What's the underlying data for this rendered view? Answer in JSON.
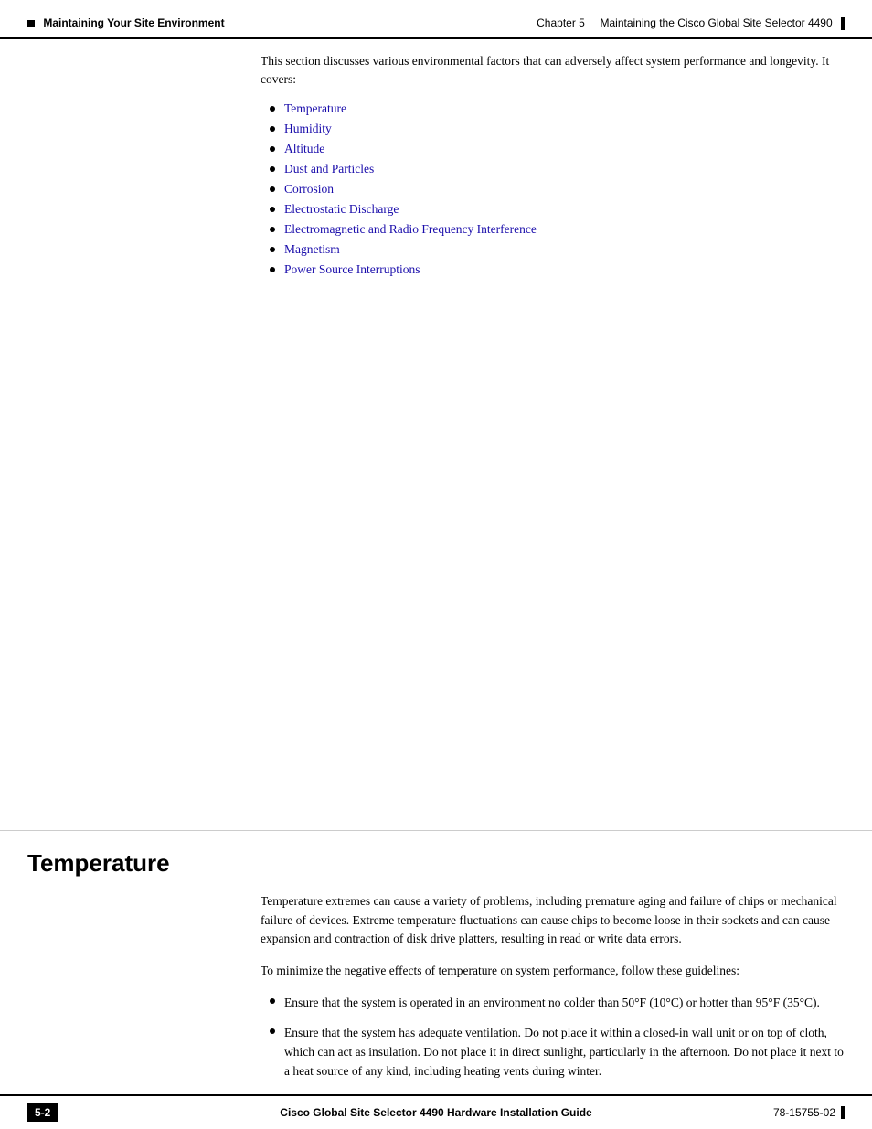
{
  "header": {
    "chapter": "Chapter 5",
    "chapter_title": "Maintaining the Cisco Global Site Selector 4490",
    "section_label": "Maintaining Your Site Environment"
  },
  "intro": {
    "text": "This section discusses various environmental factors that can adversely affect system performance and longevity. It covers:"
  },
  "bullet_links": [
    "Temperature",
    "Humidity",
    "Altitude",
    "Dust and Particles",
    "Corrosion",
    "Electrostatic Discharge",
    "Electromagnetic and Radio Frequency Interference",
    "Magnetism",
    "Power Source Interruptions"
  ],
  "temperature_section": {
    "heading": "Temperature",
    "paragraph1": "Temperature extremes can cause a variety of problems, including premature aging and failure of chips or mechanical failure of devices. Extreme temperature fluctuations can cause chips to become loose in their sockets and can cause expansion and contraction of disk drive platters, resulting in read or write data errors.",
    "paragraph2": "To minimize the negative effects of temperature on system performance, follow these guidelines:",
    "bullets": [
      "Ensure that the system is operated in an environment no colder than 50°F (10°C) or hotter than 95°F (35°C).",
      "Ensure that the system has adequate ventilation. Do not place it within a closed-in wall unit or on top of cloth, which can act as insulation. Do not place it in direct sunlight, particularly in the afternoon. Do not place it next to a heat source of any kind, including heating vents during winter."
    ]
  },
  "footer": {
    "page_number": "5-2",
    "guide_title": "Cisco Global Site Selector 4490 Hardware Installation Guide",
    "doc_number": "78-15755-02"
  }
}
